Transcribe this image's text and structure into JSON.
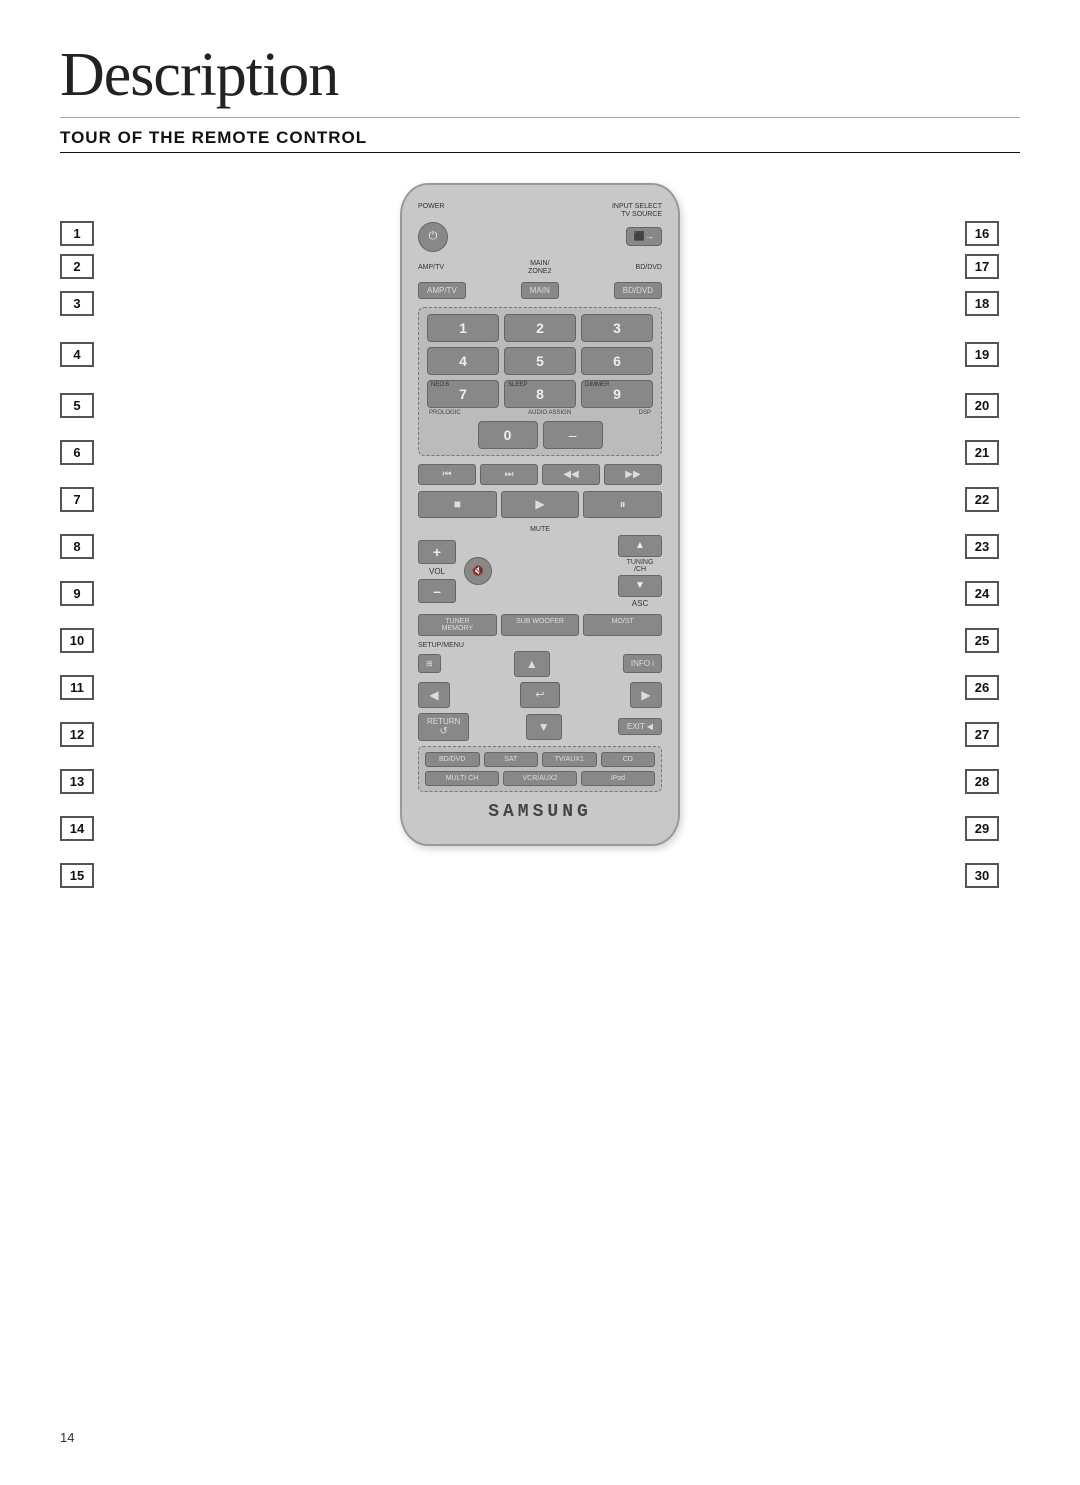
{
  "title": "Description",
  "section": "TOUR OF THE REMOTE CONTROL",
  "page_number": "14",
  "left_callouts": [
    "1",
    "2",
    "3",
    "4",
    "5",
    "6",
    "7",
    "8",
    "9",
    "10",
    "11",
    "12",
    "13",
    "14",
    "15"
  ],
  "right_callouts": [
    "16",
    "17",
    "18",
    "19",
    "20",
    "21",
    "22",
    "23",
    "24",
    "25",
    "26",
    "27",
    "28",
    "29",
    "30"
  ],
  "remote": {
    "labels": {
      "power": "POWER",
      "input_select": "INPUT SELECT",
      "tv_source": "TV SOURCE",
      "main_zone2": "MAIN/ ZONE2",
      "amp_tv": "AMP/TV",
      "bd_dvd": "BD/DVD",
      "neo6": "NEO:6",
      "sleep": "SLEEP",
      "dimmer": "DIMMER",
      "prologic": "PROLOGIC",
      "audio_assign": "AUDIO ASSIGN",
      "dsp": "DSP",
      "mute": "MUTE",
      "vol": "VOL",
      "asc": "ASC",
      "tuning_ch": "TUNING /CH",
      "tuner_memory": "TUNER MEMORY",
      "sub_woofer": "SUB WOOFER",
      "mo_st": "MO/ST",
      "setup_menu": "SETUP/MENU",
      "info": "INFO i",
      "return": "RETURN",
      "exit": "EXIT",
      "bd_dvd2": "BD/DVD",
      "sat": "SAT",
      "tv_aux1": "TV/AUX1",
      "cd": "CD",
      "multi_ch": "MULTI CH",
      "vcr_aux2": "VCR/AUX2",
      "ipod": "iPod",
      "samsung": "SAMSUNG"
    }
  }
}
